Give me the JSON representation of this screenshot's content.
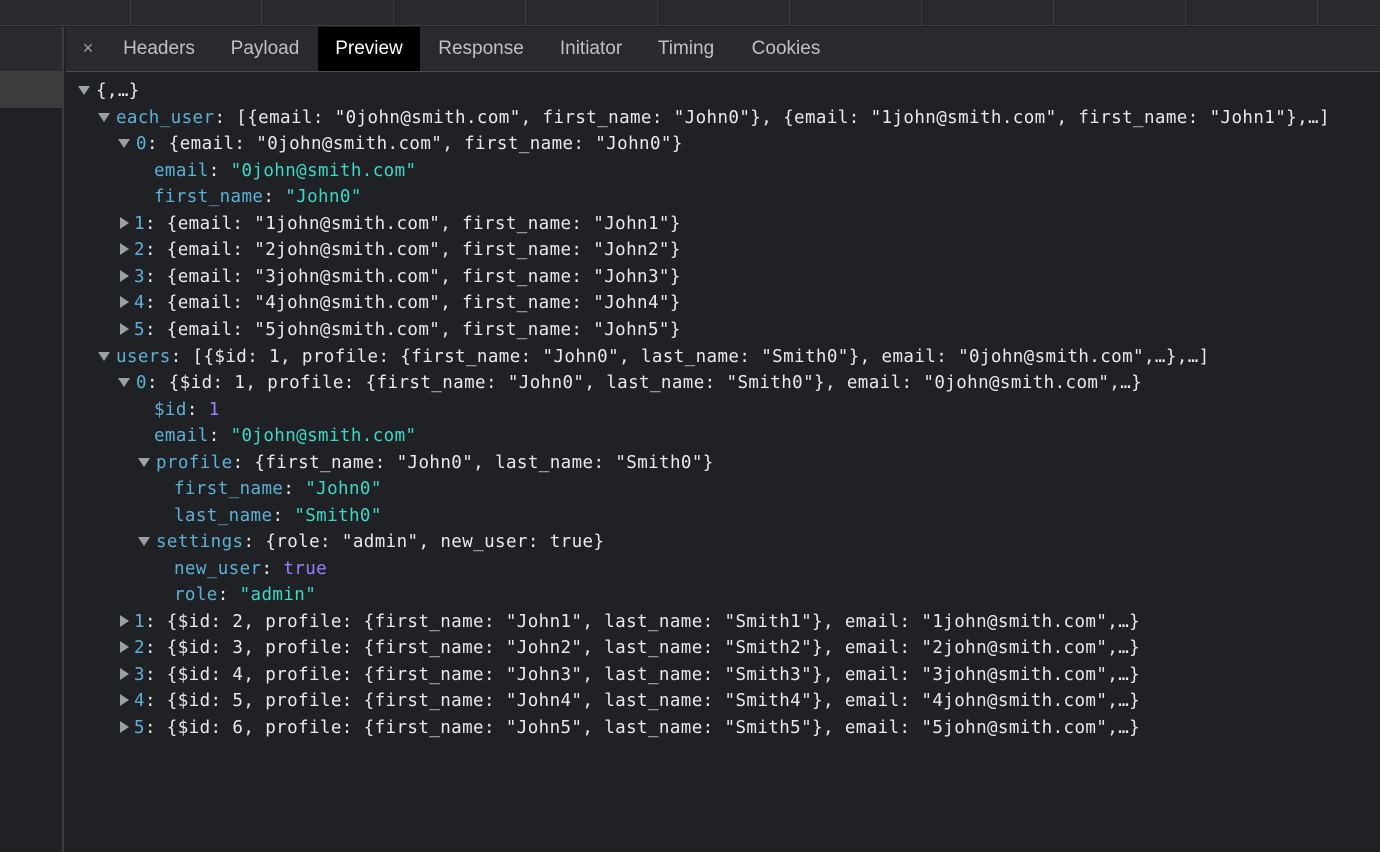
{
  "tabs": {
    "close_glyph": "×",
    "items": [
      "Headers",
      "Payload",
      "Preview",
      "Response",
      "Initiator",
      "Timing",
      "Cookies"
    ],
    "active": "Preview"
  },
  "colors": {
    "background": "#202124",
    "key": "#5db0d7",
    "string": "#3dd8c8",
    "number": "#9980ff",
    "text": "#e8eaed"
  },
  "tree": {
    "root": "{,…}",
    "each_user": {
      "key": "each_user",
      "summary": ": [{email: \"0john@smith.com\", first_name: \"John0\"}, {email: \"1john@smith.com\", first_name: \"John1\"},…]",
      "item0": {
        "key": "0",
        "summary": ": {email: \"0john@smith.com\", first_name: \"John0\"}",
        "email_key": "email",
        "email_val": "\"0john@smith.com\"",
        "first_name_key": "first_name",
        "first_name_val": "\"John0\""
      },
      "collapsed": [
        {
          "key": "1",
          "summary": ": {email: \"1john@smith.com\", first_name: \"John1\"}"
        },
        {
          "key": "2",
          "summary": ": {email: \"2john@smith.com\", first_name: \"John2\"}"
        },
        {
          "key": "3",
          "summary": ": {email: \"3john@smith.com\", first_name: \"John3\"}"
        },
        {
          "key": "4",
          "summary": ": {email: \"4john@smith.com\", first_name: \"John4\"}"
        },
        {
          "key": "5",
          "summary": ": {email: \"5john@smith.com\", first_name: \"John5\"}"
        }
      ]
    },
    "users": {
      "key": "users",
      "summary": ": [{$id: 1, profile: {first_name: \"John0\", last_name: \"Smith0\"}, email: \"0john@smith.com\",…},…]",
      "item0": {
        "key": "0",
        "summary": ": {$id: 1, profile: {first_name: \"John0\", last_name: \"Smith0\"}, email: \"0john@smith.com\",…}",
        "id_key": "$id",
        "id_val": "1",
        "email_key": "email",
        "email_val": "\"0john@smith.com\"",
        "profile": {
          "key": "profile",
          "summary": ": {first_name: \"John0\", last_name: \"Smith0\"}",
          "first_name_key": "first_name",
          "first_name_val": "\"John0\"",
          "last_name_key": "last_name",
          "last_name_val": "\"Smith0\""
        },
        "settings": {
          "key": "settings",
          "summary": ": {role: \"admin\", new_user: true}",
          "new_user_key": "new_user",
          "new_user_val": "true",
          "role_key": "role",
          "role_val": "\"admin\""
        }
      },
      "collapsed": [
        {
          "key": "1",
          "summary": ": {$id: 2, profile: {first_name: \"John1\", last_name: \"Smith1\"}, email: \"1john@smith.com\",…}"
        },
        {
          "key": "2",
          "summary": ": {$id: 3, profile: {first_name: \"John2\", last_name: \"Smith2\"}, email: \"2john@smith.com\",…}"
        },
        {
          "key": "3",
          "summary": ": {$id: 4, profile: {first_name: \"John3\", last_name: \"Smith3\"}, email: \"3john@smith.com\",…}"
        },
        {
          "key": "4",
          "summary": ": {$id: 5, profile: {first_name: \"John4\", last_name: \"Smith4\"}, email: \"4john@smith.com\",…}"
        },
        {
          "key": "5",
          "summary": ": {$id: 6, profile: {first_name: \"John5\", last_name: \"Smith5\"}, email: \"5john@smith.com\",…}"
        }
      ]
    }
  }
}
